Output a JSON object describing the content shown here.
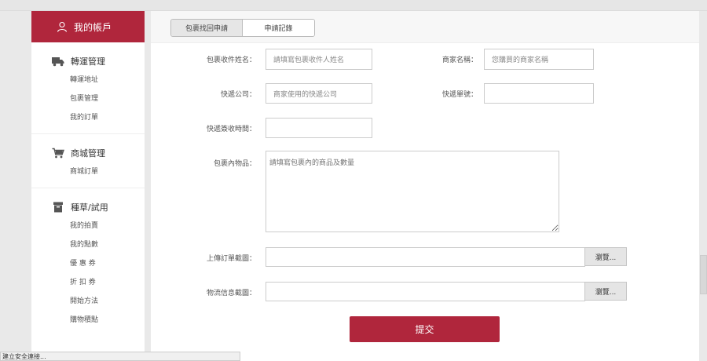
{
  "sidebar": {
    "header": "我的帳戶",
    "sections": [
      {
        "title": "轉運管理",
        "icon": "truck-icon",
        "items": [
          "轉運地址",
          "包裹管理",
          "我的訂單"
        ]
      },
      {
        "title": "商城管理",
        "icon": "cart-icon",
        "items": [
          "商城訂單"
        ]
      },
      {
        "title": "種草/試用",
        "icon": "box-icon",
        "items": [
          "我的拍賣",
          "我的點數",
          "優 惠 券",
          "折 扣 券",
          "開始方法",
          "購物積點"
        ]
      }
    ]
  },
  "tabs": [
    "包裹找回申請",
    "申請記錄"
  ],
  "form": {
    "recipient_label": "包裹收件姓名：",
    "recipient_placeholder": "請填寫包裹收件人姓名",
    "merchant_label": "商家名稱：",
    "merchant_placeholder": "您購買的商家名稱",
    "courier_label": "快遞公司：",
    "courier_placeholder": "商家使用的快遞公司",
    "tracking_label": "快遞單號：",
    "tracking_placeholder": "",
    "signed_time_label": "快遞簽收時間：",
    "signed_time_placeholder": "",
    "contents_label": "包裹內物品：",
    "contents_placeholder": "請填寫包裹內的商品及數量",
    "order_screenshot_label": "上傳訂單截圖：",
    "logistics_screenshot_label": "物流信息截圖：",
    "browse_label": "瀏覽...",
    "submit_label": "提交"
  },
  "status_bar": "建立安全連接..."
}
